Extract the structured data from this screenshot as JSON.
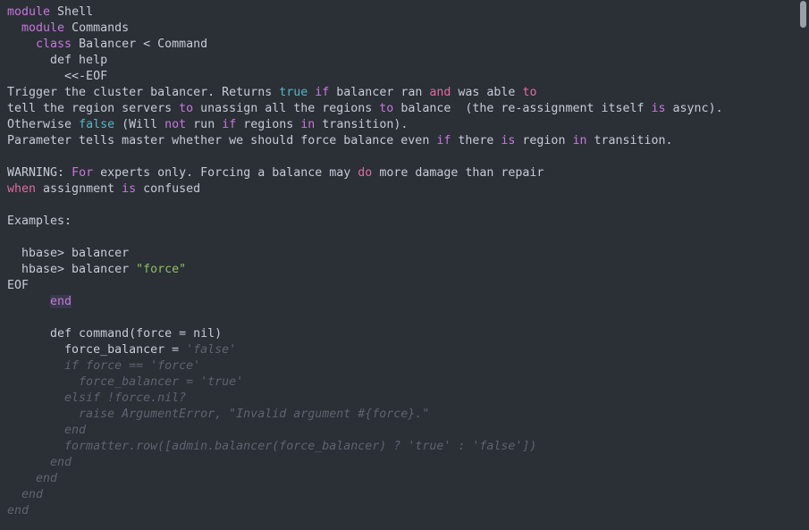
{
  "window": {
    "background_color": "#2b2f36",
    "text_color": "#c6ccd6",
    "keyword_color": "#c678dd",
    "literal_color": "#56b6c2",
    "string_color": "#8fbf5f",
    "dimmed_color": "#5d646f",
    "scrollbar_thumb_color": "#aeb4bd"
  },
  "code": {
    "language": "ruby",
    "lines": [
      {
        "n": 1,
        "tokens": [
          {
            "t": "module",
            "c": "kw"
          },
          {
            "t": " Shell",
            "c": "txt"
          }
        ]
      },
      {
        "n": 2,
        "tokens": [
          {
            "t": "  ",
            "c": "txt"
          },
          {
            "t": "module",
            "c": "kw"
          },
          {
            "t": " Commands",
            "c": "txt"
          }
        ]
      },
      {
        "n": 3,
        "tokens": [
          {
            "t": "    ",
            "c": "txt"
          },
          {
            "t": "class",
            "c": "kw"
          },
          {
            "t": " Balancer < Command",
            "c": "txt"
          }
        ]
      },
      {
        "n": 4,
        "tokens": [
          {
            "t": "      def help",
            "c": "txt"
          }
        ]
      },
      {
        "n": 5,
        "tokens": [
          {
            "t": "        <<-EOF",
            "c": "txt"
          }
        ]
      },
      {
        "n": 6,
        "tokens": [
          {
            "t": "Trigger the cluster balancer. Returns ",
            "c": "txt"
          },
          {
            "t": "true",
            "c": "lit"
          },
          {
            "t": " ",
            "c": "txt"
          },
          {
            "t": "if",
            "c": "kw"
          },
          {
            "t": " balancer ran ",
            "c": "txt"
          },
          {
            "t": "and",
            "c": "kw2"
          },
          {
            "t": " was able ",
            "c": "txt"
          },
          {
            "t": "to",
            "c": "kw2"
          }
        ]
      },
      {
        "n": 7,
        "tokens": [
          {
            "t": "tell the region servers ",
            "c": "txt"
          },
          {
            "t": "to",
            "c": "kw"
          },
          {
            "t": " unassign all the regions ",
            "c": "txt"
          },
          {
            "t": "to",
            "c": "kw"
          },
          {
            "t": " balance  (the re-assignment itself ",
            "c": "txt"
          },
          {
            "t": "is",
            "c": "kw"
          },
          {
            "t": " async).",
            "c": "txt"
          }
        ]
      },
      {
        "n": 8,
        "tokens": [
          {
            "t": "Otherwise ",
            "c": "txt"
          },
          {
            "t": "false",
            "c": "lit"
          },
          {
            "t": " (Will ",
            "c": "txt"
          },
          {
            "t": "not",
            "c": "kw"
          },
          {
            "t": " run ",
            "c": "txt"
          },
          {
            "t": "if",
            "c": "kw"
          },
          {
            "t": " regions ",
            "c": "txt"
          },
          {
            "t": "in",
            "c": "kw"
          },
          {
            "t": " transition).",
            "c": "txt"
          }
        ]
      },
      {
        "n": 9,
        "tokens": [
          {
            "t": "Parameter tells master whether we should force balance even ",
            "c": "txt"
          },
          {
            "t": "if",
            "c": "kw"
          },
          {
            "t": " there ",
            "c": "txt"
          },
          {
            "t": "is",
            "c": "kw"
          },
          {
            "t": " region ",
            "c": "txt"
          },
          {
            "t": "in",
            "c": "kw"
          },
          {
            "t": " transition.",
            "c": "txt"
          }
        ]
      },
      {
        "n": 10,
        "tokens": []
      },
      {
        "n": 11,
        "tokens": [
          {
            "t": "WARNING: ",
            "c": "txt"
          },
          {
            "t": "For",
            "c": "kw"
          },
          {
            "t": " experts only. Forcing a balance may ",
            "c": "txt"
          },
          {
            "t": "do",
            "c": "kw2"
          },
          {
            "t": " more damage than repair",
            "c": "txt"
          }
        ]
      },
      {
        "n": 12,
        "tokens": [
          {
            "t": "when",
            "c": "kw2"
          },
          {
            "t": " assignment ",
            "c": "txt"
          },
          {
            "t": "is",
            "c": "kw"
          },
          {
            "t": " confused",
            "c": "txt"
          }
        ]
      },
      {
        "n": 13,
        "tokens": []
      },
      {
        "n": 14,
        "tokens": [
          {
            "t": "Examples:",
            "c": "txt"
          }
        ]
      },
      {
        "n": 15,
        "tokens": []
      },
      {
        "n": 16,
        "tokens": [
          {
            "t": "  hbase> balancer",
            "c": "txt"
          }
        ]
      },
      {
        "n": 17,
        "tokens": [
          {
            "t": "  hbase> balancer ",
            "c": "txt"
          },
          {
            "t": "\"force\"",
            "c": "str"
          }
        ]
      },
      {
        "n": 18,
        "tokens": [
          {
            "t": "EOF",
            "c": "txt"
          }
        ]
      },
      {
        "n": 19,
        "tokens": [
          {
            "t": "      ",
            "c": "txt"
          },
          {
            "t": "end",
            "c": "end-hl"
          }
        ]
      },
      {
        "n": 20,
        "tokens": []
      },
      {
        "n": 21,
        "tokens": [
          {
            "t": "      def command(force = nil)",
            "c": "txt"
          }
        ]
      },
      {
        "n": 22,
        "tokens": [
          {
            "t": "        force_balancer = ",
            "c": "txt"
          },
          {
            "t": "'false'",
            "c": "dimstr"
          }
        ]
      },
      {
        "n": 23,
        "tokens": [
          {
            "t": "        if force == 'force'",
            "c": "dim"
          }
        ]
      },
      {
        "n": 24,
        "tokens": [
          {
            "t": "          force_balancer = 'true'",
            "c": "dim"
          }
        ]
      },
      {
        "n": 25,
        "tokens": [
          {
            "t": "        elsif !force.nil?",
            "c": "dim"
          }
        ]
      },
      {
        "n": 26,
        "tokens": [
          {
            "t": "          raise ArgumentError, \"Invalid argument #{force}.\"",
            "c": "dim"
          }
        ]
      },
      {
        "n": 27,
        "tokens": [
          {
            "t": "        end",
            "c": "dim"
          }
        ]
      },
      {
        "n": 28,
        "tokens": [
          {
            "t": "        formatter.row([admin.balancer(force_balancer) ? 'true' : 'false'])",
            "c": "dim"
          }
        ]
      },
      {
        "n": 29,
        "tokens": [
          {
            "t": "      end",
            "c": "dim"
          }
        ]
      },
      {
        "n": 30,
        "tokens": [
          {
            "t": "    end",
            "c": "dim"
          }
        ]
      },
      {
        "n": 31,
        "tokens": [
          {
            "t": "  end",
            "c": "dim"
          }
        ]
      },
      {
        "n": 32,
        "tokens": [
          {
            "t": "end",
            "c": "dim"
          }
        ]
      }
    ]
  },
  "scrollbar": {
    "position": "top-right",
    "visible": true
  }
}
